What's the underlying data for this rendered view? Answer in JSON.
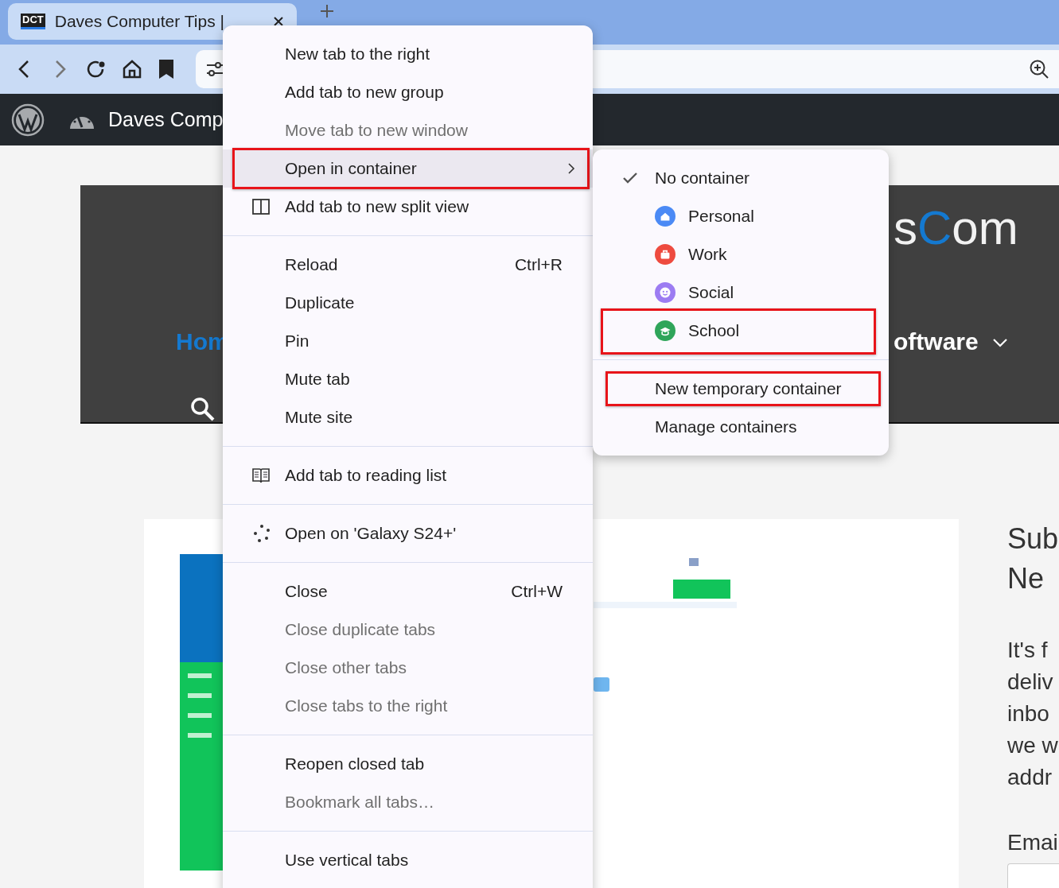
{
  "browser": {
    "tab": {
      "favicon_text": "DCT",
      "title": "Daves Computer Tips |"
    }
  },
  "admin_bar": {
    "site_name": "Daves Comp"
  },
  "site_header": {
    "logo_parts": [
      {
        "text": "s",
        "accent": false
      },
      {
        "text": "C",
        "accent": true
      },
      {
        "text": "om",
        "accent": false
      }
    ],
    "nav": [
      {
        "label": "Hom",
        "kind": "link"
      },
      {
        "label": "oftware",
        "kind": "dropdown"
      }
    ]
  },
  "sidebar": {
    "heading_lines": [
      "Sub",
      "Ne"
    ],
    "text_lines": [
      "It's f",
      "deliv",
      "inbo",
      "we w",
      "addr"
    ],
    "email_label": "Emai"
  },
  "context_menu": {
    "sections": [
      [
        {
          "label": "New tab to the right",
          "kind": "plain",
          "disabled": false,
          "submenu": false,
          "highlighted": false
        },
        {
          "label": "Add tab to new group",
          "kind": "plain",
          "disabled": false,
          "submenu": false,
          "highlighted": false
        },
        {
          "label": "Move tab to new window",
          "kind": "plain",
          "disabled": true,
          "submenu": false,
          "highlighted": false
        },
        {
          "label": "Open in container",
          "kind": "plain",
          "disabled": false,
          "submenu": true,
          "highlighted": true
        },
        {
          "label": "Add tab to new split view",
          "kind": "split",
          "disabled": false,
          "submenu": false,
          "highlighted": false
        }
      ],
      [
        {
          "label": "Reload",
          "shortcut": "Ctrl+R",
          "kind": "plain",
          "disabled": false,
          "submenu": false,
          "highlighted": false
        },
        {
          "label": "Duplicate",
          "kind": "plain",
          "disabled": false,
          "submenu": false,
          "highlighted": false
        },
        {
          "label": "Pin",
          "kind": "plain",
          "disabled": false,
          "submenu": false,
          "highlighted": false
        },
        {
          "label": "Mute tab",
          "kind": "plain",
          "disabled": false,
          "submenu": false,
          "highlighted": false
        },
        {
          "label": "Mute site",
          "kind": "plain",
          "disabled": false,
          "submenu": false,
          "highlighted": false
        }
      ],
      [
        {
          "label": "Add tab to reading list",
          "kind": "reading",
          "disabled": false,
          "submenu": false,
          "highlighted": false
        }
      ],
      [
        {
          "label": "Open on 'Galaxy S24+'",
          "kind": "device",
          "disabled": false,
          "submenu": false,
          "highlighted": false
        }
      ],
      [
        {
          "label": "Close",
          "shortcut": "Ctrl+W",
          "kind": "plain",
          "disabled": false,
          "submenu": false,
          "highlighted": false
        },
        {
          "label": "Close duplicate tabs",
          "kind": "plain",
          "disabled": true,
          "submenu": false,
          "highlighted": false
        },
        {
          "label": "Close other tabs",
          "kind": "plain",
          "disabled": true,
          "submenu": false,
          "highlighted": false
        },
        {
          "label": "Close tabs to the right",
          "kind": "plain",
          "disabled": true,
          "submenu": false,
          "highlighted": false
        }
      ],
      [
        {
          "label": "Reopen closed tab",
          "kind": "plain",
          "disabled": false,
          "submenu": false,
          "highlighted": false
        },
        {
          "label": "Bookmark all tabs…",
          "kind": "plain",
          "disabled": true,
          "submenu": false,
          "highlighted": false
        }
      ],
      [
        {
          "label": "Use vertical tabs",
          "kind": "plain",
          "disabled": false,
          "submenu": false,
          "highlighted": false
        }
      ]
    ]
  },
  "container_submenu": {
    "sections": [
      [
        {
          "label": "No container",
          "kind": "option",
          "checked": true,
          "highlighted": false
        },
        {
          "label": "Personal",
          "kind": "home",
          "color": "#4b8af5",
          "checked": false,
          "highlighted": false
        },
        {
          "label": "Work",
          "kind": "briefcase",
          "color": "#ee4b3f",
          "checked": false,
          "highlighted": false
        },
        {
          "label": "Social",
          "kind": "smile",
          "color": "#9c7cf2",
          "checked": false,
          "highlighted": false
        },
        {
          "label": "School",
          "kind": "cap",
          "color": "#2fa55a",
          "checked": false,
          "highlighted": true
        }
      ],
      [
        {
          "label": "New temporary container",
          "kind": "option",
          "checked": false,
          "highlighted": true
        },
        {
          "label": "Manage containers",
          "kind": "option",
          "checked": false,
          "highlighted": false
        }
      ]
    ]
  }
}
